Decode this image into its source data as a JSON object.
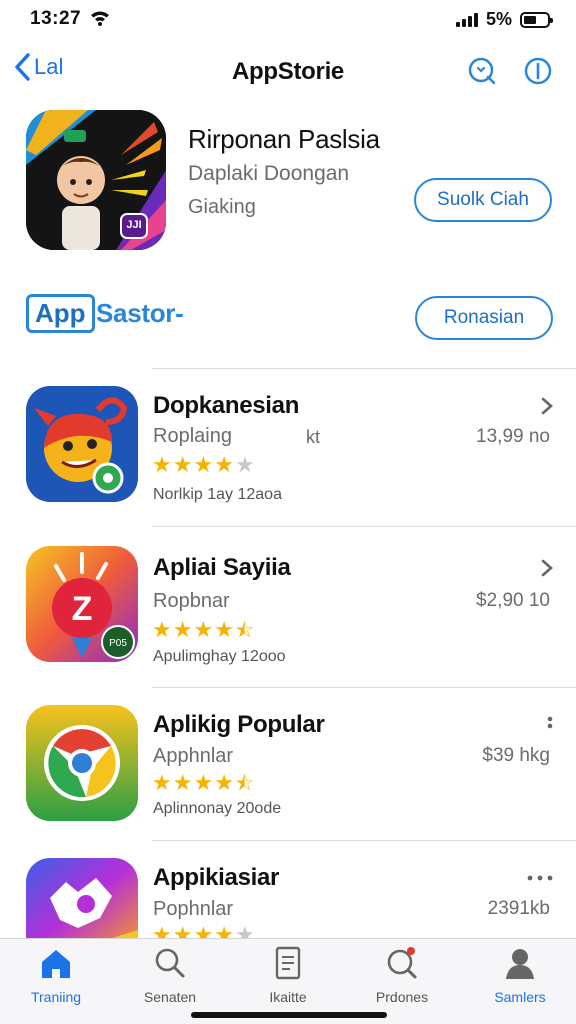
{
  "status_bar": {
    "time": "13:27",
    "battery": "5%"
  },
  "nav": {
    "back_label": "Lal",
    "title": "AppStorie",
    "icons": [
      "chat-icon",
      "info-icon"
    ]
  },
  "featured": {
    "title": "Rirponan Paslsia",
    "subtitle": "Daplaki Doongan",
    "category": "Giaking",
    "button_label": "Suolk Ciah",
    "icon_badge": "JJI"
  },
  "section": {
    "badge": "App",
    "title": "Sastor-",
    "button_label": "Ronasian"
  },
  "apps": [
    {
      "name": "Dopkanesian",
      "category": "Roplaing",
      "extra": "kt",
      "rating": 4,
      "meta": "Norlkip 1ay 12aoa",
      "price": "13,99 no",
      "action": "chevron-right-icon",
      "icon_text": ""
    },
    {
      "name": "Apliai Sayiia",
      "category": "Ropbnar",
      "extra": "",
      "rating": 4.5,
      "meta": "Apulimghay 12ooo",
      "price": "$2,90 10",
      "action": "chevron-right-icon",
      "icon_text": "Z"
    },
    {
      "name": "Aplikig Popular",
      "category": "Apphnlar",
      "extra": "",
      "rating": 4.5,
      "meta": "Aplinnonay 20ode",
      "price": "$39 hkg",
      "action": "more-vertical-icon",
      "icon_text": ""
    },
    {
      "name": "Appikiasiar",
      "category": "Pophnlar",
      "extra": "",
      "rating": 4,
      "meta": "",
      "price": "2391kb",
      "action": "more-horizontal-icon",
      "icon_text": ""
    }
  ],
  "tabs": [
    {
      "label": "Traniing",
      "icon": "home-icon",
      "active": true
    },
    {
      "label": "Senaten",
      "icon": "search-icon",
      "active": false
    },
    {
      "label": "Ikaitte",
      "icon": "document-icon",
      "active": false
    },
    {
      "label": "Prdones",
      "icon": "notification-search-icon",
      "active": false
    },
    {
      "label": "Samlers",
      "icon": "person-icon",
      "active": false
    }
  ],
  "colors": {
    "accent": "#1a73e8",
    "star": "#f5b400",
    "pill_border": "#2a86d9"
  }
}
